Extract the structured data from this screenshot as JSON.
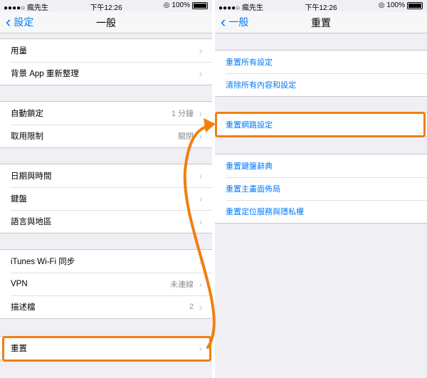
{
  "left": {
    "status": {
      "carrier": "●●●●○ 瘋先生",
      "time": "下午12:26",
      "battery": "100%"
    },
    "nav": {
      "back": "設定",
      "title": "一般"
    },
    "groups": [
      [
        {
          "label": "用量",
          "value": ""
        },
        {
          "label": "背景 App 重新整理",
          "value": ""
        }
      ],
      [
        {
          "label": "自動鎖定",
          "value": "1 分鐘"
        },
        {
          "label": "取用限制",
          "value": "關閉"
        }
      ],
      [
        {
          "label": "日期與時間",
          "value": ""
        },
        {
          "label": "鍵盤",
          "value": ""
        },
        {
          "label": "語言與地區",
          "value": ""
        }
      ],
      [
        {
          "label": "iTunes Wi-Fi 同步",
          "value": ""
        },
        {
          "label": "VPN",
          "value": "未連線"
        },
        {
          "label": "描述檔",
          "value": "2"
        }
      ],
      [
        {
          "label": "重置",
          "value": ""
        }
      ]
    ]
  },
  "right": {
    "status": {
      "carrier": "●●●●○ 瘋先生",
      "time": "下午12:26",
      "battery": "100%"
    },
    "nav": {
      "back": "一般",
      "title": "重置"
    },
    "groups": [
      [
        "重置所有設定",
        "清除所有內容和設定"
      ],
      [
        "重置網路設定"
      ],
      [
        "重置鍵盤辭典",
        "重置主畫面佈局",
        "重置定位服務與隱私權"
      ]
    ]
  },
  "chevron": "›",
  "back_chevron": "‹",
  "accent_color": "#f07f10",
  "link_color": "#007aff"
}
